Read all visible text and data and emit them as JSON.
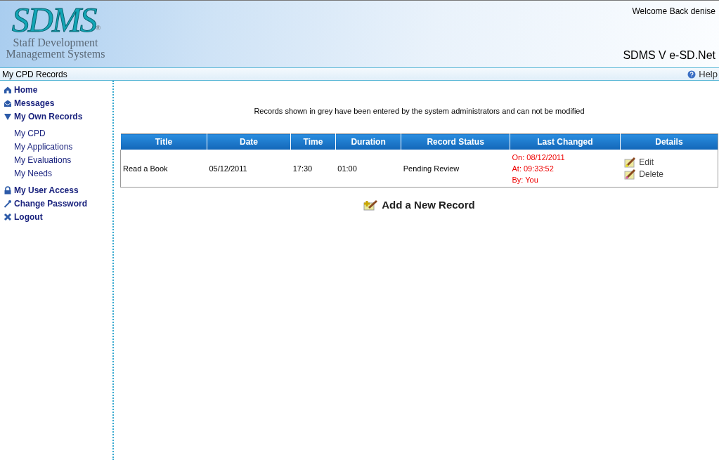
{
  "header": {
    "logo": {
      "mark": "SDMS",
      "registered": "®",
      "line_1": "Staff Development",
      "line_2": "Management Systems"
    },
    "welcome": "Welcome Back denise",
    "product": "SDMS V e-SD.Net"
  },
  "breadcrumb": {
    "title": "My CPD Records",
    "help": "Help"
  },
  "sidebar": {
    "items": [
      {
        "label": "Home"
      },
      {
        "label": "Messages"
      },
      {
        "label": "My Own Records",
        "expanded": true,
        "children": [
          {
            "label": "My CPD"
          },
          {
            "label": "My Applications"
          },
          {
            "label": "My Evaluations"
          },
          {
            "label": "My Needs"
          }
        ]
      },
      {
        "label": "My User Access"
      },
      {
        "label": "Change Password"
      },
      {
        "label": "Logout"
      }
    ]
  },
  "notice": "Records shown in grey have been entered by the system administrators and can not be modified",
  "table": {
    "columns": [
      "Title",
      "Date",
      "Time",
      "Duration",
      "Record Status",
      "Last Changed",
      "Details"
    ],
    "rows": [
      {
        "title": "Read a Book",
        "date": "05/12/2011",
        "time": "17:30",
        "duration": "01:00",
        "status": "Pending Review",
        "last_changed": [
          "On: 08/12/2011",
          "At: 09:33:52",
          "By: You"
        ],
        "actions": [
          "Edit",
          "Delete"
        ]
      }
    ]
  },
  "add_button": "Add a New Record"
}
